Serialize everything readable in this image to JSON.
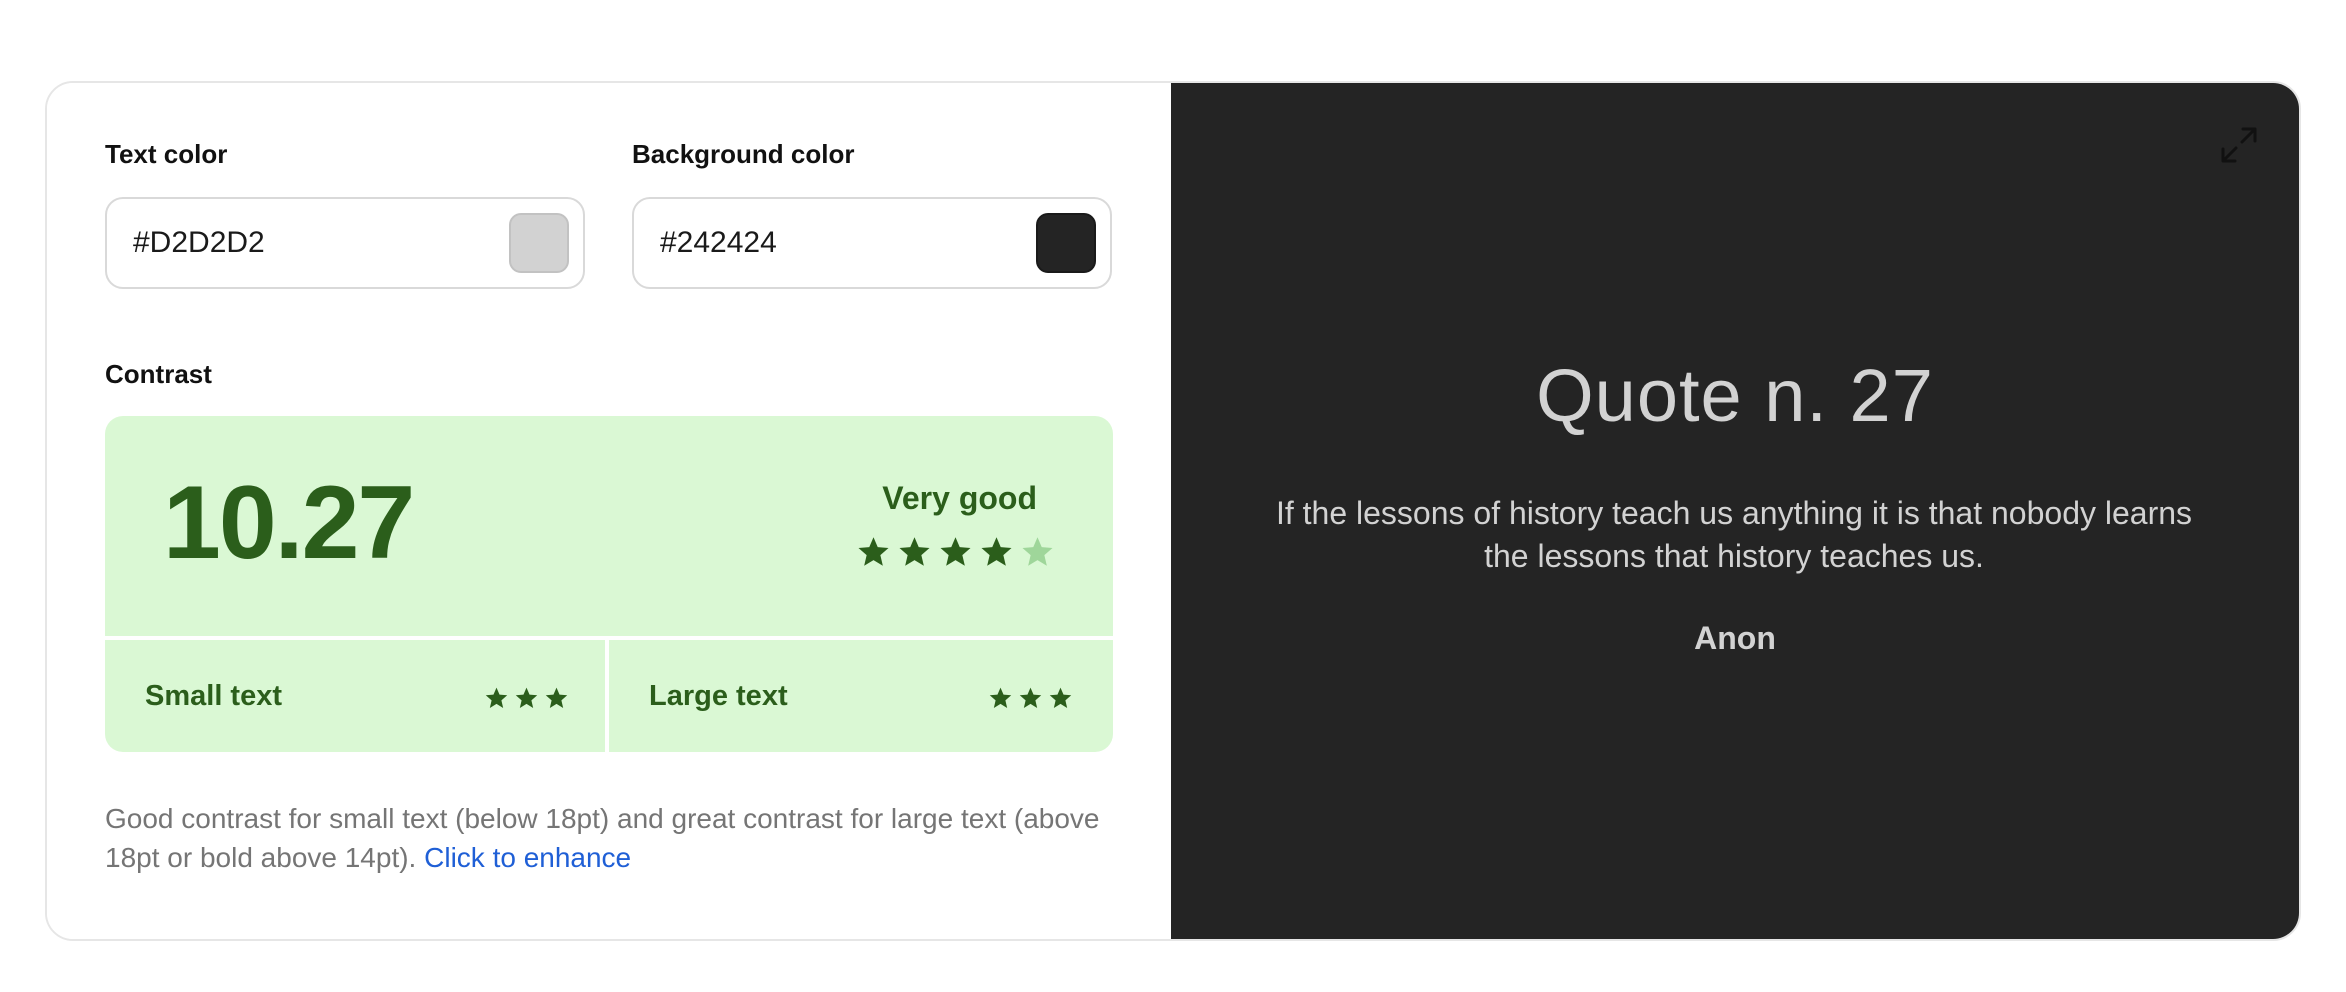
{
  "text_color": {
    "label": "Text color",
    "value": "#D2D2D2",
    "swatch": "#D2D2D2"
  },
  "background_color": {
    "label": "Background color",
    "value": "#242424",
    "swatch": "#242424"
  },
  "contrast": {
    "label": "Contrast",
    "ratio": "10.27",
    "rating": "Very good",
    "stars_filled": 4,
    "stars_total": 5,
    "small_text": {
      "label": "Small text",
      "stars": 3
    },
    "large_text": {
      "label": "Large text",
      "stars": 3
    },
    "colors": {
      "panel_bg": "#daf8d4",
      "accent": "#2b5e1b",
      "star_empty": "#9fd69a"
    }
  },
  "description": {
    "text": "Good contrast for small text (below 18pt) and great contrast for large text (above 18pt or bold above 14pt).",
    "link": "Click to enhance"
  },
  "preview": {
    "expand_icon": "expand-icon",
    "title": "Quote n. 27",
    "quote": "If the lessons of history teach us anything it is that nobody learns the lessons that history teaches us.",
    "author": "Anon"
  }
}
